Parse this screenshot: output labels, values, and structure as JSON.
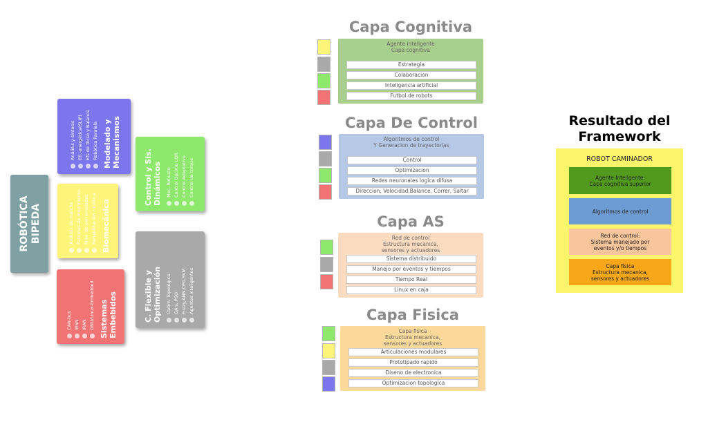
{
  "main_title": "ROBÓTICA BIPEDA",
  "cards": {
    "modelado": {
      "title": "Modelado y Mecanismos",
      "items": [
        "Análisis y síntesis",
        "Efi. energética(SLIP)",
        "Efs de Torso y Balance",
        "Robótica Paralela"
      ]
    },
    "biomecanica": {
      "title": "Biomecánica",
      "items": [
        "Análisis de marcha",
        "Patrones de movimiento",
        "Mod. de extremidades",
        "Rehabilitación robótica"
      ]
    },
    "sistemas": {
      "title": "Sistemas Embebidos",
      "items": [
        "CAN-bus",
        "WSN",
        "IRAN",
        "GNU/Linux-Embedded"
      ]
    },
    "control": {
      "title": "Control y Sis. Dinámicos",
      "items": [
        "Mec. Robusto",
        "Control Optimo LQR",
        "Control Adaptativo",
        "Control de torque"
      ]
    },
    "flexible": {
      "title": "C. Flexible y Optimización",
      "items": [
        "Optim. Topológica",
        "GA's, PSO",
        "Fuzzy,ANN,CPG,SVM",
        "Agentes inteligentes"
      ]
    }
  },
  "layers": {
    "cognitiva": {
      "title": "Capa Cognitiva",
      "head": [
        "Agente inteligente",
        "Capa cognitiva"
      ],
      "rows": [
        "Estrategia",
        "Colaboracion",
        "Inteligencia artificial",
        "Futbol de robots"
      ],
      "color": "#a9cf8f"
    },
    "control": {
      "title": "Capa De Control",
      "head": [
        "Algoritmos de control",
        "Y Generacion de trayectorias"
      ],
      "rows": [
        "Control",
        "Optimizacion",
        "Redes neuronales logica difusa",
        "Direccion, Velocidad,Balance, Correr, Saltar"
      ],
      "color": "#b5c9e6"
    },
    "as": {
      "title": "Capa AS",
      "head": [
        "Red de control",
        "Estructura mecanica,",
        "sensores y actuadores"
      ],
      "rows": [
        "Sistema distribuido",
        "Manejo por eventos y tiempos",
        "Tiempo Real",
        "Linux en caja"
      ],
      "color": "#fbdcc0"
    },
    "fisica": {
      "title": "Capa Fisica",
      "head": [
        "Capa fisica",
        "Estructura mecanica,",
        "sensores y actuadores"
      ],
      "rows": [
        "Articulaciones modulares",
        "Prototipado rapido",
        "Diseno de electronica",
        "Optimizacion topologica"
      ],
      "color": "#fbd99a"
    }
  },
  "result": {
    "title_line1": "Resultado del",
    "title_line2": "Framework",
    "box_label": "ROBOT CAMINADOR",
    "items": [
      {
        "lines": [
          "Agente Inteligente:",
          "Capa cognitiva superior"
        ],
        "color": "#529a1e"
      },
      {
        "lines": [
          "Algoritmos de control"
        ],
        "color": "#6f9bd3"
      },
      {
        "lines": [
          "Red de control:",
          "Sistema manejado por",
          "eventos y/o tiempos"
        ],
        "color": "#f9c59b"
      },
      {
        "lines": [
          "Capa fisica",
          "Estructura mecanica,",
          "sensores y actuadores"
        ],
        "color": "#f7a717"
      }
    ]
  },
  "colors": {
    "purple": "#7b76ec",
    "yellow": "#fdf579",
    "red": "#f27373",
    "green": "#8ee86c",
    "gray": "#a9a9a9",
    "teal": "#7fa1a4"
  }
}
